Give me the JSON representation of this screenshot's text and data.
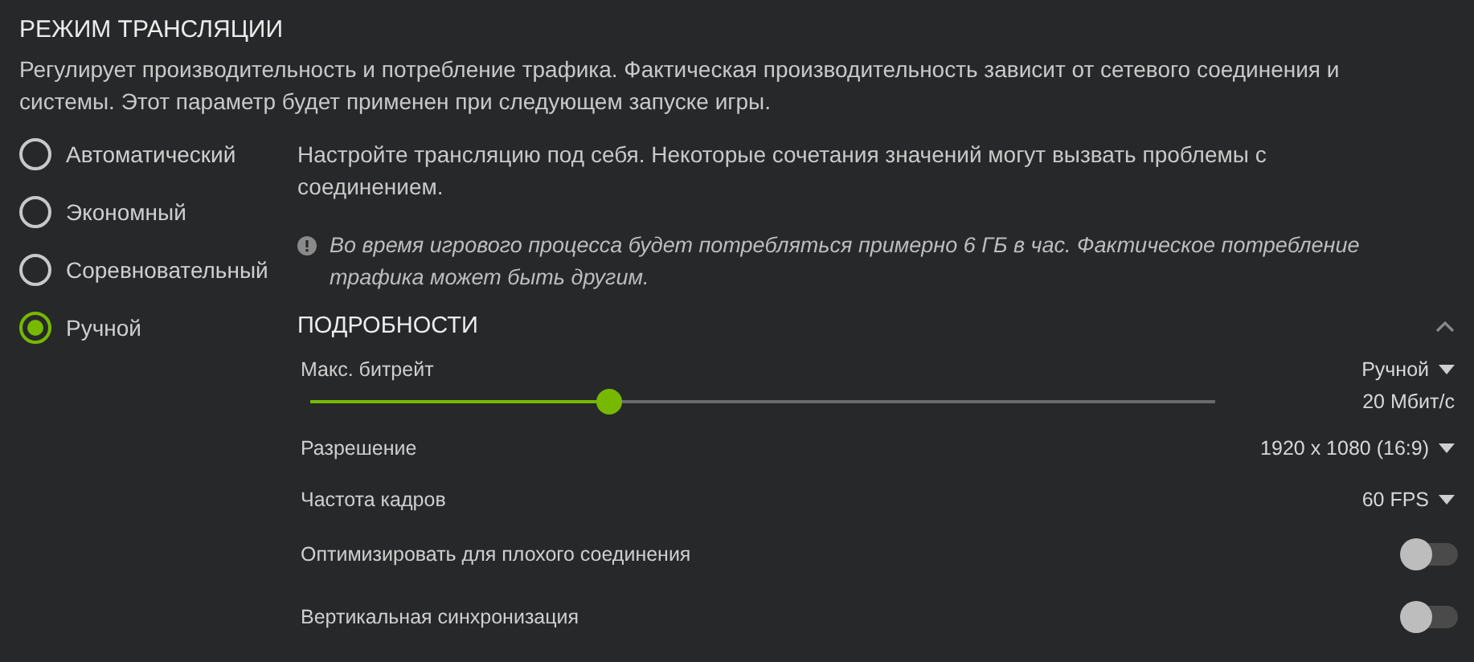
{
  "title": "РЕЖИМ ТРАНСЛЯЦИИ",
  "description": "Регулирует производительность и потребление трафика. Фактическая производительность зависит от сетевого соединения и системы. Этот параметр будет применен при следующем запуске игры.",
  "modes": [
    {
      "label": "Автоматический",
      "selected": false
    },
    {
      "label": "Экономный",
      "selected": false
    },
    {
      "label": "Соревновательный",
      "selected": false
    },
    {
      "label": "Ручной",
      "selected": true
    }
  ],
  "hint": "Настройте трансляцию под себя. Некоторые сочетания значений могут вызвать проблемы с соединением.",
  "notice": "Во время игрового процесса будет потребляться примерно 6 ГБ в час. Фактическое потребление трафика может быть другим.",
  "details": {
    "title": "ПОДРОБНОСТИ",
    "expanded": true,
    "settings": [
      {
        "kind": "slider",
        "label": "Макс. битрейт",
        "value": "Ручной",
        "level": 0.33,
        "reading": "20 Мбит/с"
      },
      {
        "kind": "dropdown",
        "label": "Разрешение",
        "value": "1920 x 1080 (16:9)"
      },
      {
        "kind": "dropdown",
        "label": "Частота кадров",
        "value": "60 FPS"
      },
      {
        "kind": "toggle",
        "label": "Оптимизировать для плохого соединения",
        "on": false
      },
      {
        "kind": "toggle",
        "label": "Вертикальная синхронизация",
        "on": false
      }
    ]
  }
}
